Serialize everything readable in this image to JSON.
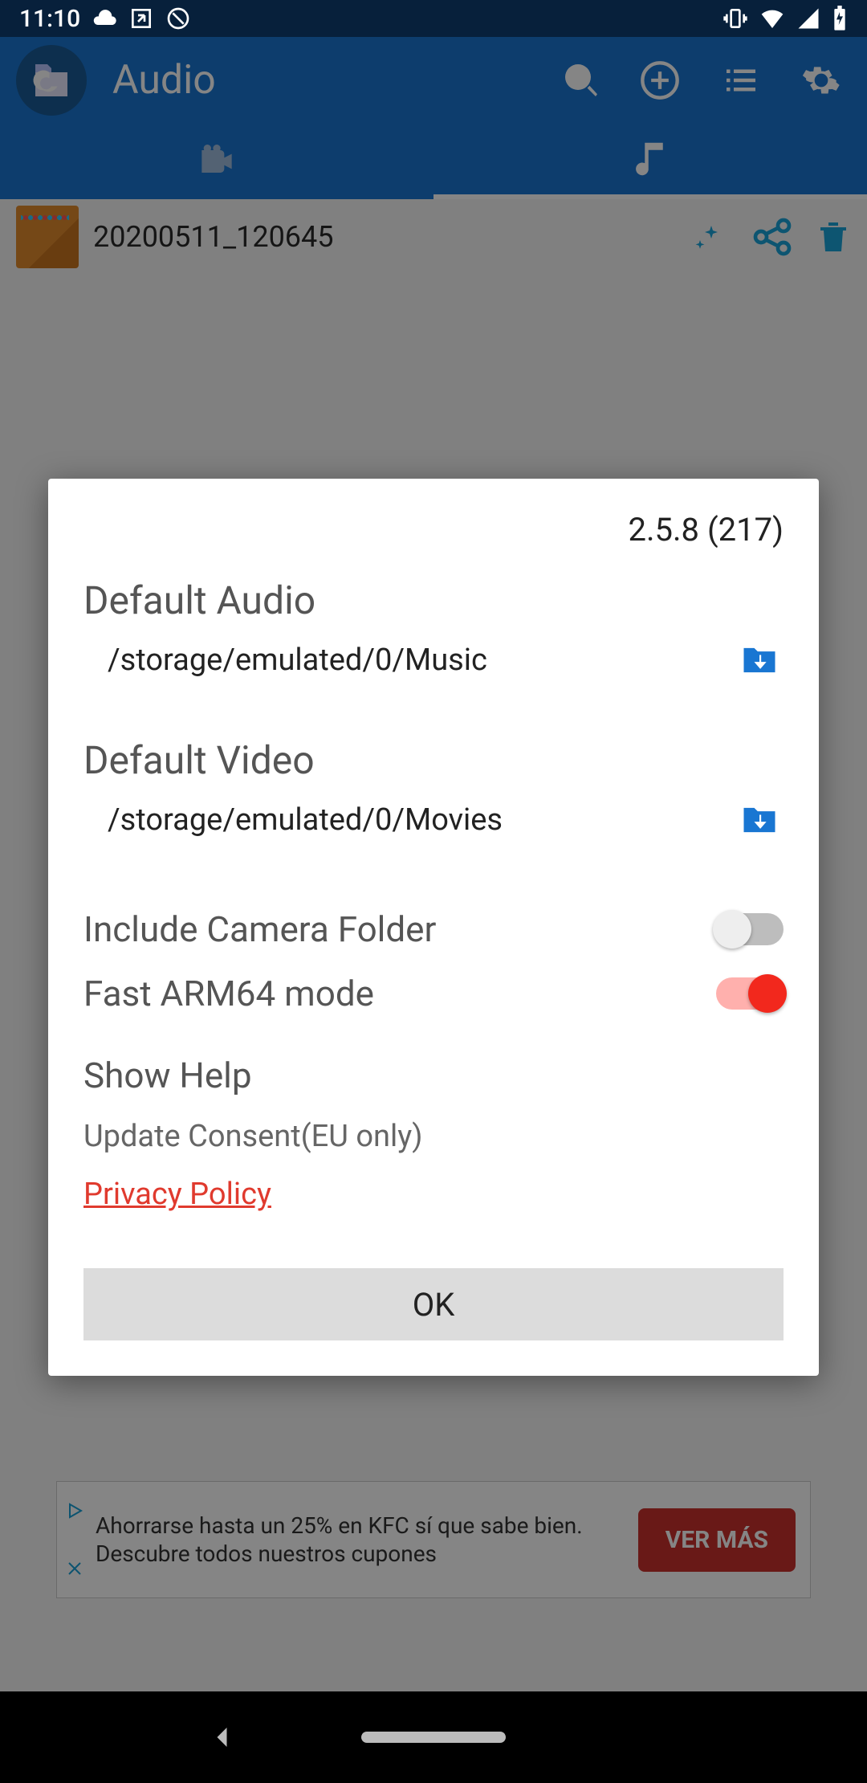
{
  "status": {
    "time": "11:10"
  },
  "app": {
    "title": "Audio"
  },
  "tabs": {
    "active": 1
  },
  "list": {
    "items": [
      {
        "name": "20200511_120645"
      }
    ]
  },
  "dialog": {
    "version": "2.5.8 (217)",
    "sections": {
      "audio": {
        "title": "Default Audio",
        "path": "/storage/emulated/0/Music"
      },
      "video": {
        "title": "Default Video",
        "path": "/storage/emulated/0/Movies"
      }
    },
    "toggles": {
      "camera": {
        "label": "Include Camera Folder",
        "on": false
      },
      "arm64": {
        "label": "Fast ARM64 mode",
        "on": true
      }
    },
    "show_help": "Show Help",
    "consent": "Update Consent(EU only)",
    "privacy": "Privacy Policy",
    "ok": "OK"
  },
  "ad": {
    "text": "Ahorrarse hasta un 25% en KFC sí que sabe bien. Descubre todos nuestros cupones",
    "cta": "VER MÁS"
  }
}
